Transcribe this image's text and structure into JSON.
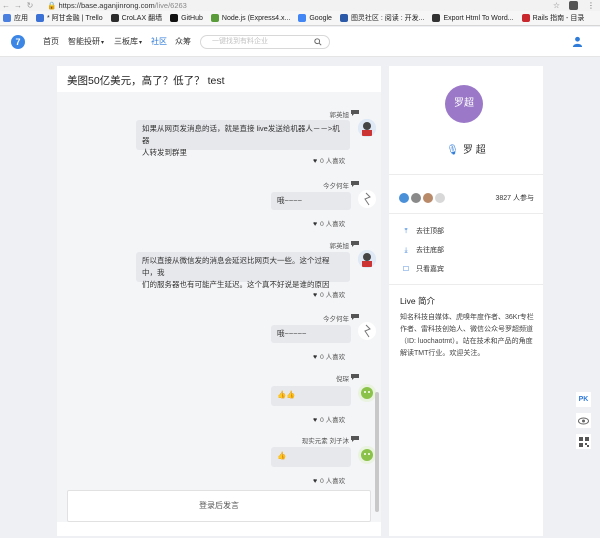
{
  "browser": {
    "url_host": "https://base.aganjinrong.com",
    "url_path": "/live/6263",
    "bookmarks": [
      {
        "label": "应用",
        "color": "#4a7fe0"
      },
      {
        "label": "* 阿甘金融 | Trello",
        "color": "#3b70d4"
      },
      {
        "label": "CroLAX 翻墙",
        "color": "#2c2c2c"
      },
      {
        "label": "GitHub",
        "color": "#111111"
      },
      {
        "label": "Node.js (Express4.x...",
        "color": "#5a9b3a"
      },
      {
        "label": "Google",
        "color": "#4285f4"
      },
      {
        "label": "图灵社区 : 阅读 : 开发...",
        "color": "#2d5aa8"
      },
      {
        "label": "Export Html To Word...",
        "color": "#333333"
      },
      {
        "label": "Rails 指南 - 目录",
        "color": "#c8282e"
      }
    ]
  },
  "header": {
    "logo_glyph": "7",
    "nav": [
      {
        "label": "首页",
        "active": false,
        "dropdown": false
      },
      {
        "label": "智能投研",
        "active": false,
        "dropdown": true
      },
      {
        "label": "三板库",
        "active": false,
        "dropdown": true
      },
      {
        "label": "社区",
        "active": true,
        "dropdown": false
      },
      {
        "label": "众筹",
        "active": false,
        "dropdown": false
      }
    ],
    "search_placeholder": "一键找到有料企业"
  },
  "chat": {
    "title": "美图50亿美元，高了？低了？ test",
    "messages": [
      {
        "name": "郭英旭",
        "text_lines": [
          "如果从网页发消息的话，就是直接 live发送给机器人－－>机器",
          "人转发到群里"
        ],
        "likes": "0 人喜欢"
      },
      {
        "name": "今夕何年",
        "text_lines": [
          "哦~~~~"
        ],
        "likes": "0 人喜欢"
      },
      {
        "name": "郭英旭",
        "text_lines": [
          "所以直接从微信发的消息会延迟比网页大一些。这个过程中，我",
          "们的服务器也有可能产生延迟。这个真不好说是谁的原因"
        ],
        "likes": "0 人喜欢"
      },
      {
        "name": "今夕何年",
        "text_lines": [
          "哦~~~~~"
        ],
        "likes": "0 人喜欢"
      },
      {
        "name": "倪琛",
        "text_lines": [
          "👍👍"
        ],
        "likes": "0 人喜欢"
      },
      {
        "name": "现实元素 刘子沐",
        "text_lines": [
          "👍"
        ],
        "likes": "0 人喜欢"
      }
    ],
    "login_prompt": "登录后发言"
  },
  "sidebar": {
    "host_avatar_text": "罗超",
    "host_name": "罗 超",
    "participants": "3827 人参与",
    "links": [
      "去往顶部",
      "去往底部",
      "只看嘉宾"
    ],
    "live_intro_title": "Live 简介",
    "live_intro_text": "知名科技自媒体、虎嗅年度作者、36Kr专栏作者、雷科技创始人、微信公众号罗超频道（ID: luochaotmt）。站在技术和产品的角度解读TMT行业。欢迎关注。"
  },
  "floating": {
    "pk_label": "PK"
  }
}
